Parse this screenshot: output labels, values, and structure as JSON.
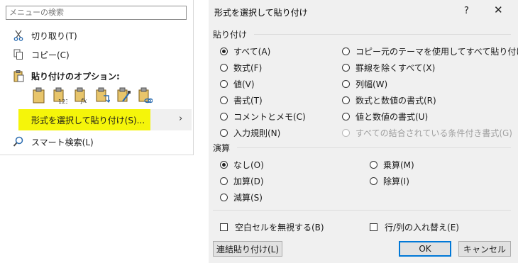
{
  "context_menu": {
    "search_placeholder": "メニューの検索",
    "cut": "切り取り(T)",
    "copy": "コピー(C)",
    "paste_options": "貼り付けのオプション:",
    "paste_special": "形式を選択して貼り付け(S)...",
    "smart_lookup": "スマート検索(L)",
    "submenu_arrow": "›",
    "highlight_color": "#f5f50a"
  },
  "dialog": {
    "title": "形式を選択して貼り付け",
    "help": "?",
    "close": "✕",
    "paste_group": "貼り付け",
    "paste_options_left": [
      "すべて(A)",
      "数式(F)",
      "値(V)",
      "書式(T)",
      "コメントとメモ(C)",
      "入力規則(N)"
    ],
    "paste_options_right": [
      "コピー元のテーマを使用してすべて貼り付け(H)",
      "罫線を除くすべて(X)",
      "列幅(W)",
      "数式と数値の書式(R)",
      "値と数値の書式(U)",
      "すべての結合されている条件付き書式(G)"
    ],
    "operation_group": "演算",
    "operation_left": [
      "なし(O)",
      "加算(D)",
      "減算(S)"
    ],
    "operation_right": [
      "乗算(M)",
      "除算(I)"
    ],
    "skip_blanks": "空白セルを無視する(B)",
    "transpose": "行/列の入れ替え(E)",
    "paste_link": "連結貼り付け(L)",
    "ok": "OK",
    "cancel": "キャンセル",
    "accent": "#0078d7"
  }
}
